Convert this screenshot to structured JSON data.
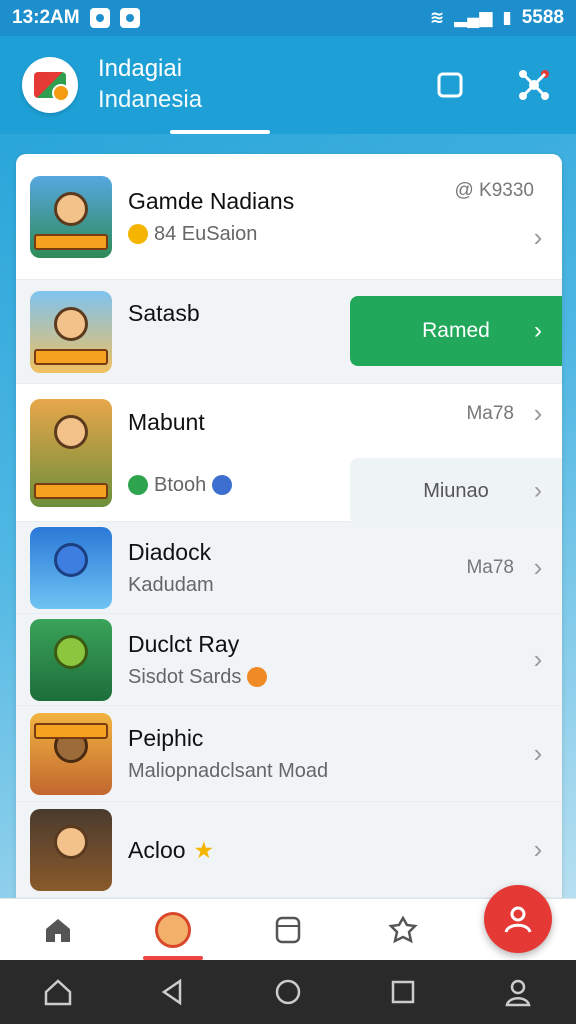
{
  "status_bar": {
    "time": "13:2AM",
    "right_text": "5588"
  },
  "header": {
    "title": "Indagiai",
    "subtitle": "Indanesia"
  },
  "list": {
    "items": [
      {
        "title": "Gamde Nadians",
        "subtitle": "84  EuSaion",
        "right": "@ K9330"
      },
      {
        "title": "Satasb",
        "subtitle": "",
        "right": "",
        "action_label": "Ramed"
      },
      {
        "title": "Mabunt",
        "subtitle": "Btooh",
        "right": "Ma78",
        "chip_label": "Miunao"
      },
      {
        "title": "Diadock",
        "subtitle": "Kadudam",
        "right": "Ma78"
      },
      {
        "title": "Duclct Ray",
        "subtitle": "Sisdot Sards",
        "right": ""
      },
      {
        "title": "Peiphic",
        "subtitle": "Maliopnadclsant Moad",
        "right": ""
      },
      {
        "title": "Acloo",
        "subtitle": "",
        "right": ""
      }
    ]
  },
  "colors": {
    "header_blue": "#1ea0d6",
    "primary_green": "#22a85b",
    "fab_red": "#e53935"
  },
  "icons": {
    "header_actions": [
      "square-icon",
      "network-icon"
    ],
    "bottom_nav": [
      "home-icon",
      "avatar-icon",
      "database-icon",
      "puzzle-icon",
      "menu-icon"
    ],
    "fab": "user-icon",
    "system_nav": [
      "home-icon",
      "back-icon",
      "circle-home-icon",
      "recents-icon",
      "user-icon"
    ]
  }
}
